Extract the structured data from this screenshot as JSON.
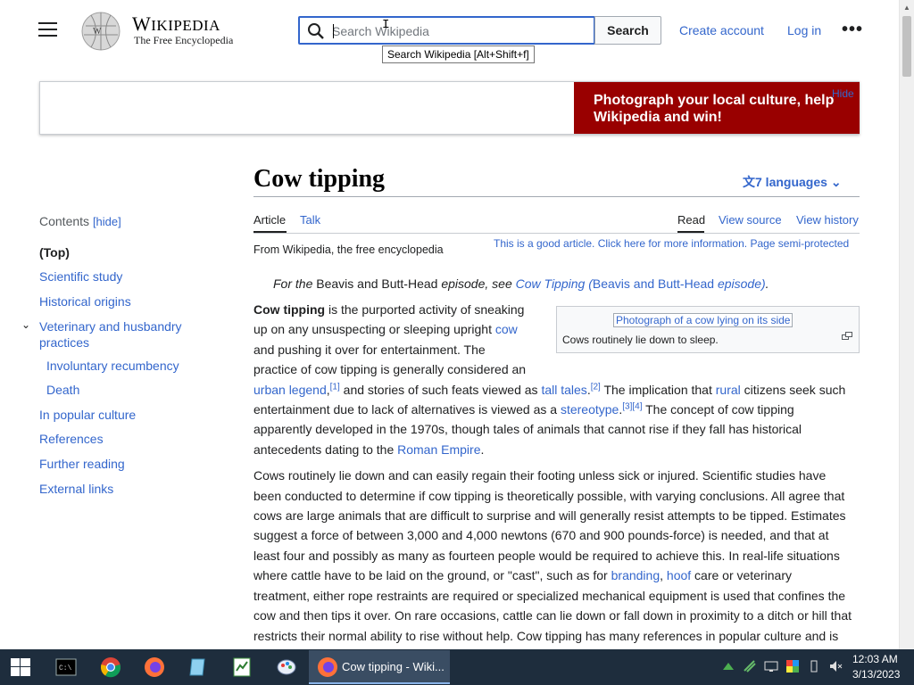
{
  "header": {
    "wordmark": "Wikipedia",
    "tagline": "The Free Encyclopedia",
    "search_placeholder": "Search Wikipedia",
    "search_button": "Search",
    "search_tooltip": "Search Wikipedia [Alt+Shift+f]",
    "create_account": "Create account",
    "login": "Log in"
  },
  "banner": {
    "text": "Photograph your local culture, help Wikipedia and win!",
    "hide": "Hide",
    "color": "#990000"
  },
  "toc": {
    "title": "Contents",
    "hide": "[hide]",
    "items": [
      {
        "label": "(Top)"
      },
      {
        "label": "Scientific study"
      },
      {
        "label": "Historical origins"
      },
      {
        "label": "Veterinary and husbandry practices"
      },
      {
        "label": "Involuntary recumbency"
      },
      {
        "label": "Death"
      },
      {
        "label": "In popular culture"
      },
      {
        "label": "References"
      },
      {
        "label": "Further reading"
      },
      {
        "label": "External links"
      }
    ]
  },
  "article": {
    "title": "Cow tipping",
    "languages": "7 languages",
    "tabs": {
      "article": "Article",
      "talk": "Talk",
      "read": "Read",
      "view_source": "View source",
      "view_history": "View history"
    },
    "from": "From Wikipedia, the free encyclopedia",
    "good_article": "This is a good article. Click here for more information. Page semi-protected",
    "hatnote": {
      "prefix": "For the ",
      "show": "Beavis and Butt-Head",
      "mid": " episode, see ",
      "link1": "Cow Tipping (",
      "link_show": "Beavis and Butt-Head",
      "link2": " episode)",
      "end": "."
    },
    "infobox": {
      "image_alt": "Photograph of a cow lying on its side",
      "caption": "Cows routinely lie down to sleep."
    },
    "p1": {
      "bold": "Cow tipping",
      "t1": " is the purported activity of sneaking",
      "t2": "up on any unsuspecting or sleeping upright ",
      "cow": "cow",
      "t3": "and pushing it over for entertainment. The",
      "t4": "practice of cow tipping is generally considered an",
      "urban_legend": "urban legend",
      "ref1": "[1]",
      "t5": " and stories of such feats viewed as ",
      "tall_tales": "tall tales",
      "ref2": "[2]",
      "t6": " The implication that ",
      "rural": "rural",
      "t7": " citizens seek such",
      "t8": "entertainment due to lack of alternatives is viewed as a ",
      "stereotype": "stereotype",
      "ref34": "[3][4]",
      "t9": " The concept of cow tipping",
      "t10": "apparently developed in the 1970s, though tales of animals that cannot rise if they fall has historical",
      "t11": "antecedents dating to the ",
      "roman_empire": "Roman Empire"
    },
    "p2": {
      "l1": "Cows routinely lie down and can easily regain their footing unless sick or injured. Scientific studies have",
      "l2": "been conducted to determine if cow tipping is theoretically possible, with varying conclusions. All agree that",
      "l3": "cows are large animals that are difficult to surprise and will generally resist attempts to be tipped. Estimates",
      "l4": "suggest a force of between 3,000 and 4,000 newtons (670 and 900 pounds-force) is needed, and that at",
      "l5": "least four and possibly as many as fourteen people would be required to achieve this. In real-life situations",
      "l6a": "where cattle have to be laid on the ground, or \"cast\", such as for ",
      "branding": "branding",
      "hoof": "hoof",
      "l6b": " care or veterinary",
      "l7": "treatment, either rope restraints are required or specialized mechanical equipment is used that confines the",
      "l8": "cow and then tips it over. On rare occasions, cattle can lie down or fall down in proximity to a ditch or hill that",
      "l9": "restricts their normal ability to rise without help. Cow tipping has many references in popular culture and is"
    }
  },
  "taskbar": {
    "active_window": "Cow tipping - Wiki...",
    "time": "12:03 AM",
    "date": "3/13/2023"
  }
}
